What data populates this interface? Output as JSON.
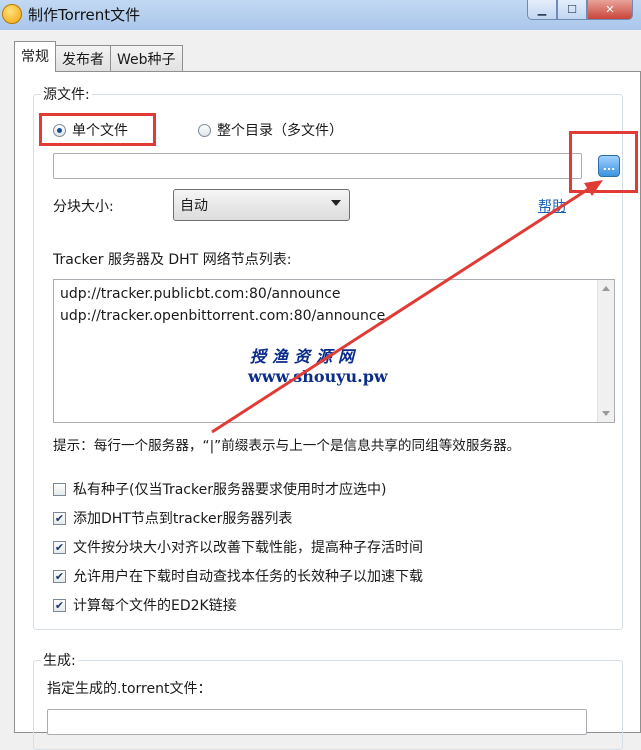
{
  "window": {
    "title": "制作Torrent文件"
  },
  "tabs": [
    {
      "label": "常规"
    },
    {
      "label": "发布者"
    },
    {
      "label": "Web种子"
    }
  ],
  "source": {
    "group_label": "源文件:",
    "radio_single": "单个文件",
    "radio_dir": "整个目录（多文件）",
    "path_value": "",
    "browse_label": "..."
  },
  "piece": {
    "label": "分块大小:",
    "selected": "自动",
    "help_link": "帮助"
  },
  "tracker": {
    "label": "Tracker 服务器及 DHT 网络节点列表:",
    "lines": [
      "udp://tracker.publicbt.com:80/announce",
      "udp://tracker.openbittorrent.com:80/announce"
    ],
    "hint": "提示：每行一个服务器，“|”前缀表示与上一个是信息共享的同组等效服务器。"
  },
  "options": [
    {
      "label": "私有种子(仅当Tracker服务器要求使用时才应选中)",
      "checked": false
    },
    {
      "label": "添加DHT节点到tracker服务器列表",
      "checked": true
    },
    {
      "label": "文件按分块大小对齐以改善下载性能，提高种子存活时间",
      "checked": true
    },
    {
      "label": "允许用户在下载时自动查找本任务的长效种子以加速下载",
      "checked": true
    },
    {
      "label": "计算每个文件的ED2K链接",
      "checked": true
    }
  ],
  "output": {
    "group_label": "生成:",
    "label": "指定生成的.torrent文件：",
    "path_value": ""
  },
  "watermark": {
    "line1": "授渔资源网",
    "line2": "www.shouyu.pw"
  },
  "colors": {
    "highlight": "#e13b36",
    "link": "#1a5fb4",
    "arrow": "#e13b36"
  }
}
